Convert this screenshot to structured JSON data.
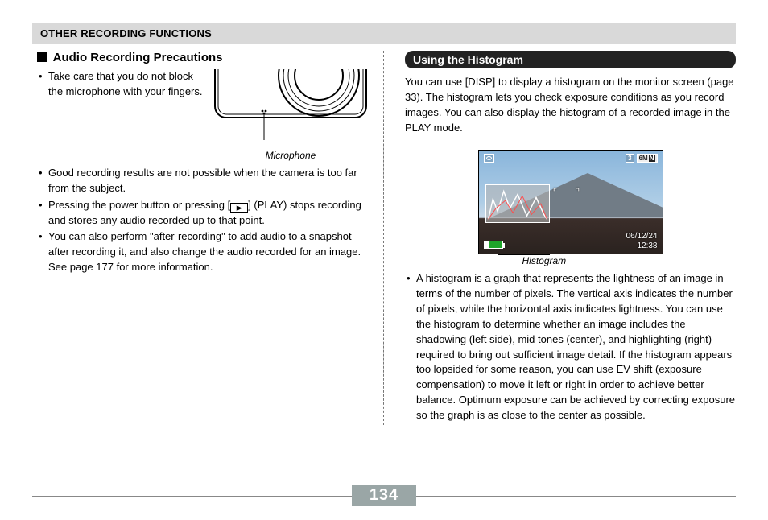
{
  "header": {
    "title": "OTHER RECORDING FUNCTIONS"
  },
  "left": {
    "subhead": "Audio Recording Precautions",
    "fig": {
      "mic_caption": "Microphone"
    },
    "bullets_top": [
      "Take care that you do not block the microphone with your fingers."
    ],
    "bullets": [
      "Good recording results are not possible when the camera is too far from the subject.",
      "Pressing the power button or pressing [▶] (PLAY) stops recording and stores any audio recorded up to that point.",
      "You can also perform \"after-recording\" to add audio to a snapshot after recording it, and also change the audio recorded for an image. See page 177 for more information."
    ]
  },
  "right": {
    "section_title": "Using the Histogram",
    "intro": "You can use [DISP] to display a histogram on the monitor screen (page 33). The histogram lets you check exposure conditions as you record images. You can also display the histogram of a recorded image in the PLAY mode.",
    "lcd": {
      "shots_remaining": "3",
      "size_label": "6M",
      "size_suffix": "N",
      "date": "06/12/24",
      "time": "12:38"
    },
    "hist_caption": "Histogram",
    "bullets": [
      "A histogram is a graph that represents the lightness of an image in terms of the number of pixels. The vertical axis indicates the number of pixels, while the horizontal axis indicates lightness. You can use the histogram to determine whether an image includes the shadowing (left side), mid tones (center), and highlighting (right) required to bring out sufficient image detail. If the histogram appears too lopsided for some reason, you can use EV shift (exposure compensation) to move it left or right in order to achieve better balance. Optimum exposure can be achieved by correcting exposure so the graph is as close to the center as possible."
    ]
  },
  "page_number": "134"
}
